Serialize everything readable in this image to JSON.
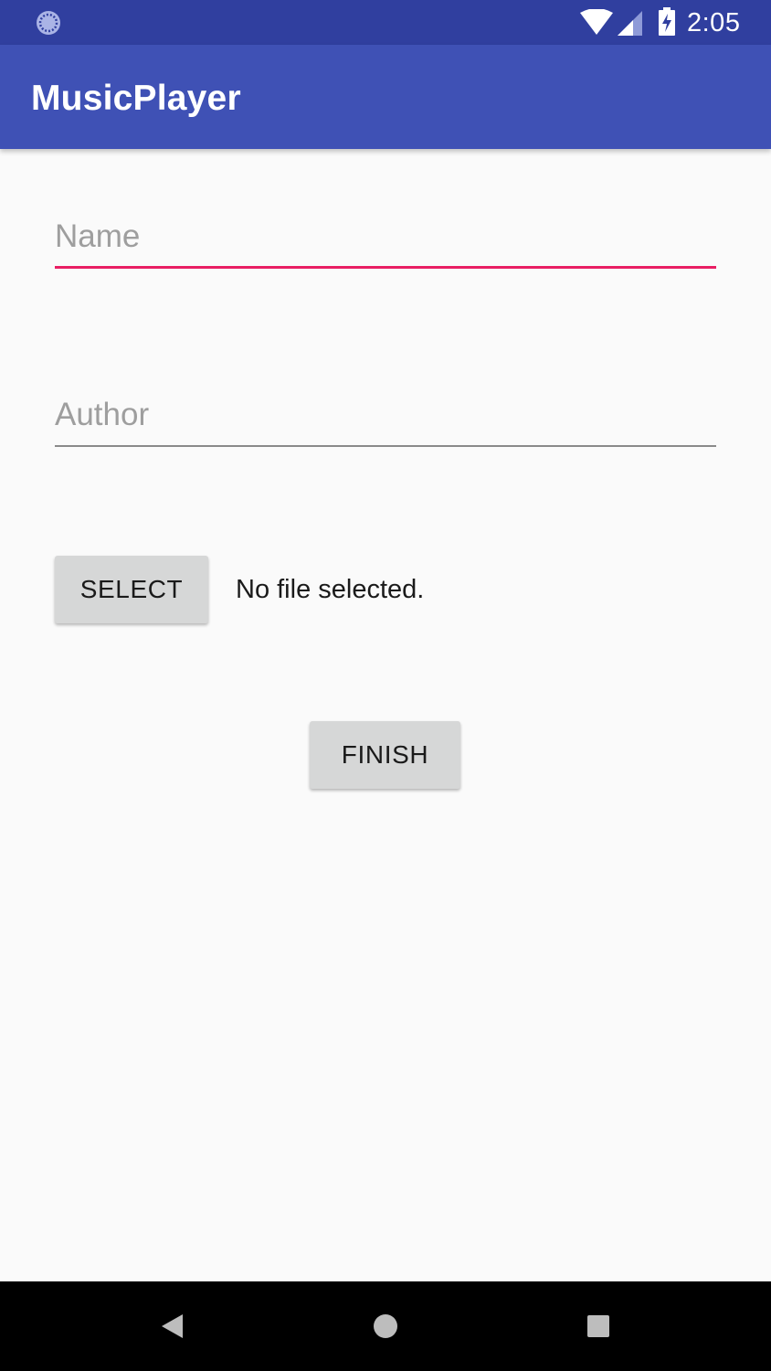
{
  "status_bar": {
    "time": "2:05",
    "icons": [
      "loader-icon",
      "wifi-icon",
      "signal-icon",
      "battery-charging-icon"
    ]
  },
  "app_bar": {
    "title": "MusicPlayer",
    "color": "#3f51b5"
  },
  "form": {
    "name_placeholder": "Name",
    "name_value": "",
    "author_placeholder": "Author",
    "author_value": "",
    "select_label": "SELECT",
    "file_status": "No file selected.",
    "finish_label": "FINISH"
  },
  "colors": {
    "status_bar": "#303f9f",
    "primary": "#3f51b5",
    "accent": "#e91e63",
    "button": "#d6d7d7"
  },
  "nav_bar": {
    "icons": [
      "back-icon",
      "home-icon",
      "recents-icon"
    ]
  }
}
